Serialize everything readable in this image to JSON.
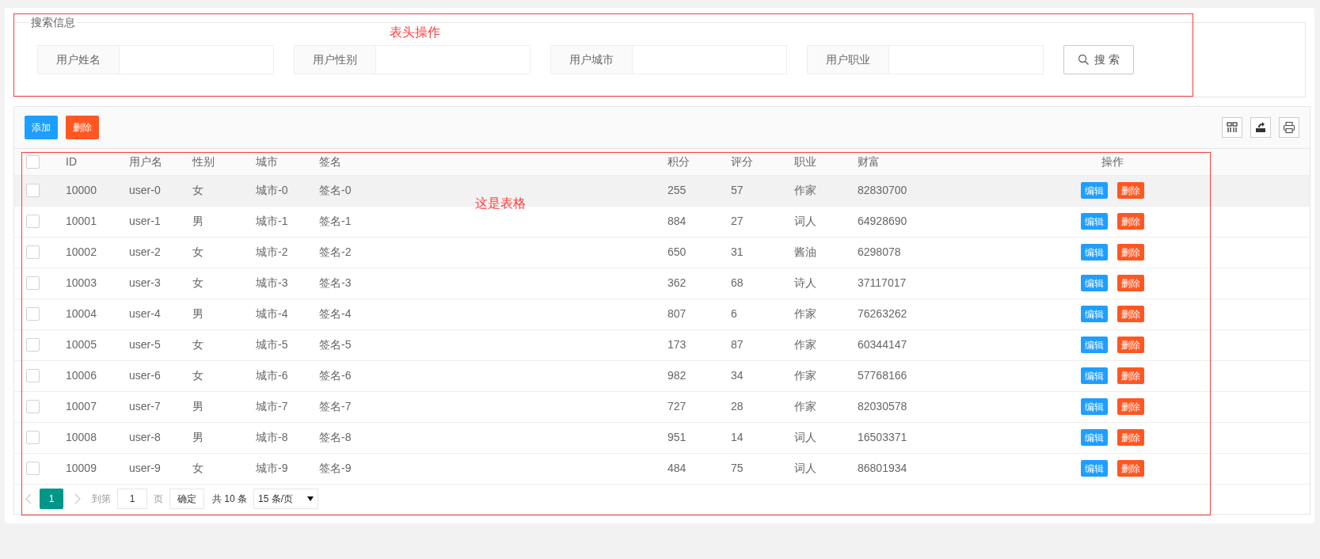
{
  "search_panel": {
    "legend": "搜索信息",
    "fields": [
      {
        "label": "用户姓名"
      },
      {
        "label": "用户性别"
      },
      {
        "label": "用户城市"
      },
      {
        "label": "用户职业"
      }
    ],
    "search_button": "搜 索"
  },
  "toolbar": {
    "buttons": [
      {
        "label": "添加",
        "kind": "primary"
      },
      {
        "label": "删除",
        "kind": "danger"
      }
    ]
  },
  "table": {
    "header_checked": false,
    "columns": [
      "ID",
      "用户名",
      "性别",
      "城市",
      "签名",
      "积分",
      "评分",
      "职业",
      "财富",
      "操作"
    ],
    "rows": [
      {
        "checked": false,
        "hovered": true,
        "cells": [
          "10000",
          "user-0",
          "女",
          "城市-0",
          "签名-0",
          "255",
          "57",
          "作家",
          "82830700"
        ]
      },
      {
        "checked": false,
        "hovered": false,
        "cells": [
          "10001",
          "user-1",
          "男",
          "城市-1",
          "签名-1",
          "884",
          "27",
          "词人",
          "64928690"
        ]
      },
      {
        "checked": false,
        "hovered": false,
        "cells": [
          "10002",
          "user-2",
          "女",
          "城市-2",
          "签名-2",
          "650",
          "31",
          "酱油",
          "6298078"
        ]
      },
      {
        "checked": false,
        "hovered": false,
        "cells": [
          "10003",
          "user-3",
          "女",
          "城市-3",
          "签名-3",
          "362",
          "68",
          "诗人",
          "37117017"
        ]
      },
      {
        "checked": false,
        "hovered": false,
        "cells": [
          "10004",
          "user-4",
          "男",
          "城市-4",
          "签名-4",
          "807",
          "6",
          "作家",
          "76263262"
        ]
      },
      {
        "checked": false,
        "hovered": false,
        "cells": [
          "10005",
          "user-5",
          "女",
          "城市-5",
          "签名-5",
          "173",
          "87",
          "作家",
          "60344147"
        ]
      },
      {
        "checked": false,
        "hovered": false,
        "cells": [
          "10006",
          "user-6",
          "女",
          "城市-6",
          "签名-6",
          "982",
          "34",
          "作家",
          "57768166"
        ]
      },
      {
        "checked": false,
        "hovered": false,
        "cells": [
          "10007",
          "user-7",
          "男",
          "城市-7",
          "签名-7",
          "727",
          "28",
          "作家",
          "82030578"
        ]
      },
      {
        "checked": false,
        "hovered": false,
        "cells": [
          "10008",
          "user-8",
          "男",
          "城市-8",
          "签名-8",
          "951",
          "14",
          "词人",
          "16503371"
        ]
      },
      {
        "checked": false,
        "hovered": false,
        "cells": [
          "10009",
          "user-9",
          "女",
          "城市-9",
          "签名-9",
          "484",
          "75",
          "词人",
          "86801934"
        ]
      }
    ],
    "row_actions": [
      [
        {
          "label": "编辑",
          "kind": "primary"
        },
        {
          "label": "删除",
          "kind": "danger"
        }
      ],
      [
        {
          "label": "编辑",
          "kind": "primary"
        },
        {
          "label": "删除",
          "kind": "danger"
        }
      ],
      [
        {
          "label": "编辑",
          "kind": "primary"
        },
        {
          "label": "删除",
          "kind": "danger"
        }
      ],
      [
        {
          "label": "编辑",
          "kind": "primary"
        },
        {
          "label": "删除",
          "kind": "danger"
        }
      ],
      [
        {
          "label": "编辑",
          "kind": "primary"
        },
        {
          "label": "删除",
          "kind": "danger"
        }
      ],
      [
        {
          "label": "编辑",
          "kind": "primary"
        },
        {
          "label": "删除",
          "kind": "danger"
        }
      ],
      [
        {
          "label": "编辑",
          "kind": "primary"
        },
        {
          "label": "删除",
          "kind": "danger"
        }
      ],
      [
        {
          "label": "编辑",
          "kind": "primary"
        },
        {
          "label": "删除",
          "kind": "danger"
        }
      ],
      [
        {
          "label": "编辑",
          "kind": "primary"
        },
        {
          "label": "删除",
          "kind": "danger"
        }
      ],
      [
        {
          "label": "编辑",
          "kind": "primary"
        },
        {
          "label": "删除",
          "kind": "danger"
        }
      ]
    ]
  },
  "pagination": {
    "pages": [
      {
        "label": "1",
        "selected": true
      }
    ],
    "goto_label": "到第",
    "goto_value": "1",
    "page_unit": "页",
    "confirm": "确定",
    "total": "共 10 条",
    "page_size": "15 条/页"
  },
  "annotations": [
    {
      "label": "表头操作"
    },
    {
      "label": "这是表格"
    }
  ]
}
